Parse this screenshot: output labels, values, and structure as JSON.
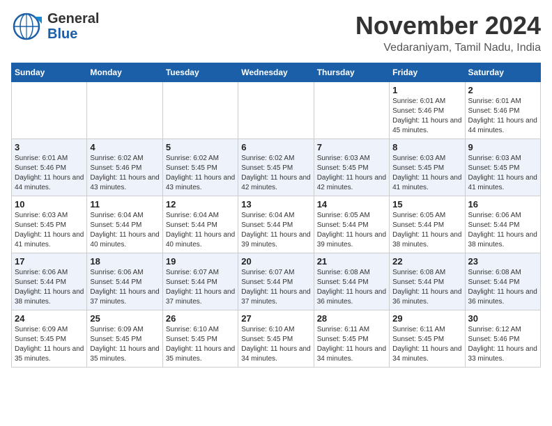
{
  "header": {
    "logo_general": "General",
    "logo_blue": "Blue",
    "month": "November 2024",
    "location": "Vedaraniyam, Tamil Nadu, India"
  },
  "weekdays": [
    "Sunday",
    "Monday",
    "Tuesday",
    "Wednesday",
    "Thursday",
    "Friday",
    "Saturday"
  ],
  "weeks": [
    [
      {
        "day": "",
        "info": ""
      },
      {
        "day": "",
        "info": ""
      },
      {
        "day": "",
        "info": ""
      },
      {
        "day": "",
        "info": ""
      },
      {
        "day": "",
        "info": ""
      },
      {
        "day": "1",
        "info": "Sunrise: 6:01 AM\nSunset: 5:46 PM\nDaylight: 11 hours and 45 minutes."
      },
      {
        "day": "2",
        "info": "Sunrise: 6:01 AM\nSunset: 5:46 PM\nDaylight: 11 hours and 44 minutes."
      }
    ],
    [
      {
        "day": "3",
        "info": "Sunrise: 6:01 AM\nSunset: 5:46 PM\nDaylight: 11 hours and 44 minutes."
      },
      {
        "day": "4",
        "info": "Sunrise: 6:02 AM\nSunset: 5:46 PM\nDaylight: 11 hours and 43 minutes."
      },
      {
        "day": "5",
        "info": "Sunrise: 6:02 AM\nSunset: 5:45 PM\nDaylight: 11 hours and 43 minutes."
      },
      {
        "day": "6",
        "info": "Sunrise: 6:02 AM\nSunset: 5:45 PM\nDaylight: 11 hours and 42 minutes."
      },
      {
        "day": "7",
        "info": "Sunrise: 6:03 AM\nSunset: 5:45 PM\nDaylight: 11 hours and 42 minutes."
      },
      {
        "day": "8",
        "info": "Sunrise: 6:03 AM\nSunset: 5:45 PM\nDaylight: 11 hours and 41 minutes."
      },
      {
        "day": "9",
        "info": "Sunrise: 6:03 AM\nSunset: 5:45 PM\nDaylight: 11 hours and 41 minutes."
      }
    ],
    [
      {
        "day": "10",
        "info": "Sunrise: 6:03 AM\nSunset: 5:45 PM\nDaylight: 11 hours and 41 minutes."
      },
      {
        "day": "11",
        "info": "Sunrise: 6:04 AM\nSunset: 5:44 PM\nDaylight: 11 hours and 40 minutes."
      },
      {
        "day": "12",
        "info": "Sunrise: 6:04 AM\nSunset: 5:44 PM\nDaylight: 11 hours and 40 minutes."
      },
      {
        "day": "13",
        "info": "Sunrise: 6:04 AM\nSunset: 5:44 PM\nDaylight: 11 hours and 39 minutes."
      },
      {
        "day": "14",
        "info": "Sunrise: 6:05 AM\nSunset: 5:44 PM\nDaylight: 11 hours and 39 minutes."
      },
      {
        "day": "15",
        "info": "Sunrise: 6:05 AM\nSunset: 5:44 PM\nDaylight: 11 hours and 38 minutes."
      },
      {
        "day": "16",
        "info": "Sunrise: 6:06 AM\nSunset: 5:44 PM\nDaylight: 11 hours and 38 minutes."
      }
    ],
    [
      {
        "day": "17",
        "info": "Sunrise: 6:06 AM\nSunset: 5:44 PM\nDaylight: 11 hours and 38 minutes."
      },
      {
        "day": "18",
        "info": "Sunrise: 6:06 AM\nSunset: 5:44 PM\nDaylight: 11 hours and 37 minutes."
      },
      {
        "day": "19",
        "info": "Sunrise: 6:07 AM\nSunset: 5:44 PM\nDaylight: 11 hours and 37 minutes."
      },
      {
        "day": "20",
        "info": "Sunrise: 6:07 AM\nSunset: 5:44 PM\nDaylight: 11 hours and 37 minutes."
      },
      {
        "day": "21",
        "info": "Sunrise: 6:08 AM\nSunset: 5:44 PM\nDaylight: 11 hours and 36 minutes."
      },
      {
        "day": "22",
        "info": "Sunrise: 6:08 AM\nSunset: 5:44 PM\nDaylight: 11 hours and 36 minutes."
      },
      {
        "day": "23",
        "info": "Sunrise: 6:08 AM\nSunset: 5:44 PM\nDaylight: 11 hours and 36 minutes."
      }
    ],
    [
      {
        "day": "24",
        "info": "Sunrise: 6:09 AM\nSunset: 5:45 PM\nDaylight: 11 hours and 35 minutes."
      },
      {
        "day": "25",
        "info": "Sunrise: 6:09 AM\nSunset: 5:45 PM\nDaylight: 11 hours and 35 minutes."
      },
      {
        "day": "26",
        "info": "Sunrise: 6:10 AM\nSunset: 5:45 PM\nDaylight: 11 hours and 35 minutes."
      },
      {
        "day": "27",
        "info": "Sunrise: 6:10 AM\nSunset: 5:45 PM\nDaylight: 11 hours and 34 minutes."
      },
      {
        "day": "28",
        "info": "Sunrise: 6:11 AM\nSunset: 5:45 PM\nDaylight: 11 hours and 34 minutes."
      },
      {
        "day": "29",
        "info": "Sunrise: 6:11 AM\nSunset: 5:45 PM\nDaylight: 11 hours and 34 minutes."
      },
      {
        "day": "30",
        "info": "Sunrise: 6:12 AM\nSunset: 5:46 PM\nDaylight: 11 hours and 33 minutes."
      }
    ]
  ]
}
